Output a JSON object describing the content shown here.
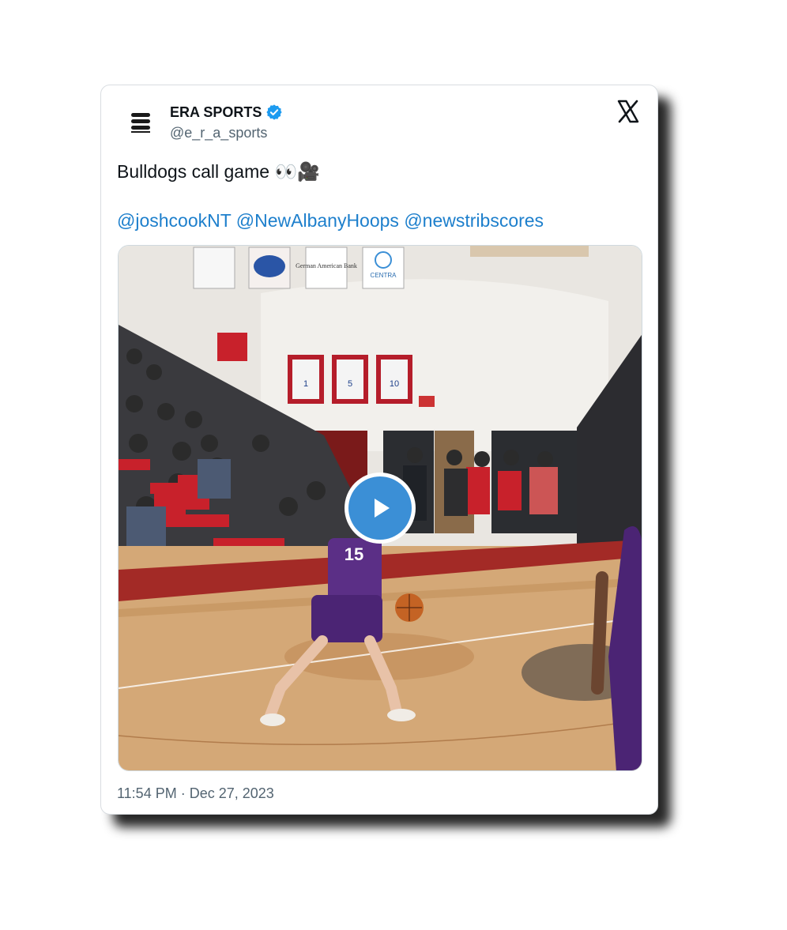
{
  "author": {
    "name": "ERA SPORTS",
    "handle": "@e_r_a_sports",
    "avatar_icon": "era-sports-logo",
    "verified": true,
    "verified_color": "#1d9bf0"
  },
  "brand": {
    "icon": "x-logo-icon"
  },
  "tweet": {
    "text": "Bulldogs call game 👀🎥",
    "mentions": [
      "@joshcookNT",
      "@NewAlbanyHoops",
      "@newstribscores"
    ]
  },
  "media": {
    "type": "video",
    "play_icon": "play-icon",
    "jersey_numbers": [
      "1",
      "5",
      "10"
    ],
    "banner_texts": [
      "German American Bank",
      "CENTRA"
    ],
    "player_number": "15"
  },
  "timestamp": "11:54 PM · Dec 27, 2023",
  "colors": {
    "link": "#1d7fcc",
    "play_button": "#3b8fd6",
    "text": "#0f1419",
    "muted": "#536471"
  }
}
